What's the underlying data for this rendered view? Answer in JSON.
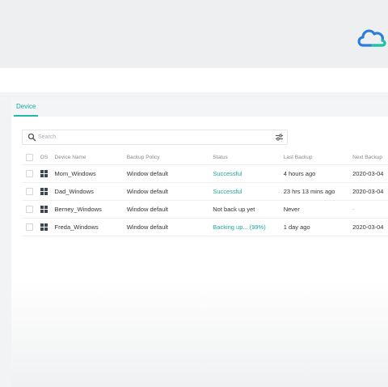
{
  "tabs": [
    {
      "label": "Device"
    }
  ],
  "search": {
    "placeholder": "Search"
  },
  "table": {
    "headers": [
      "OS",
      "Device Name",
      "Backup Policy",
      "Status",
      "Last Backup",
      "Next Backup"
    ],
    "rows": [
      {
        "name": "Mom_Windows",
        "policy": "Window default",
        "status": "Successful",
        "status_type": "success",
        "last": "4 hours  ago",
        "next": "2020-03-04"
      },
      {
        "name": "Dad_Windows",
        "policy": "Window default",
        "status": "Successful",
        "status_type": "success",
        "last": "23 hrs 13 mins ago",
        "next": "2020-03-04"
      },
      {
        "name": "Berney_Windows",
        "policy": "Window default",
        "status": "Not back up yet",
        "status_type": "none",
        "last": "Never",
        "next": "-"
      },
      {
        "name": "Freda_Windows",
        "policy": "Window default",
        "status": "Backing up... (99%)",
        "status_type": "progress",
        "last": "1 day ago",
        "next": "2020-03-04"
      }
    ]
  },
  "colors": {
    "accent": "#1aa89a",
    "logo_blue": "#2b7fd8",
    "logo_teal": "#22c4a0"
  },
  "icons": [
    "cloud-logo-icon",
    "search-icon",
    "filter-icon",
    "windows-icon"
  ]
}
